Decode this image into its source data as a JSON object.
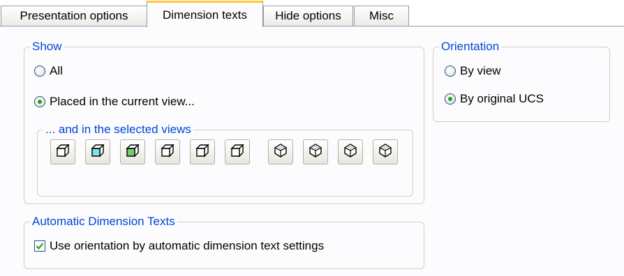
{
  "tabs": [
    {
      "label": "Presentation options",
      "active": false
    },
    {
      "label": "Dimension texts",
      "active": true
    },
    {
      "label": "Hide options",
      "active": false
    },
    {
      "label": "Misc",
      "active": false
    }
  ],
  "show": {
    "legend": "Show",
    "all_label": "All",
    "placed_label": "Placed in the current view...",
    "selected": "placed",
    "views": {
      "legend": "... and in the selected views",
      "buttons": [
        {
          "icon": "cube-iso-icon"
        },
        {
          "icon": "cube-iso-cyan-icon"
        },
        {
          "icon": "cube-iso-green-icon"
        },
        {
          "icon": "cube-iso-icon"
        },
        {
          "icon": "cube-iso-icon"
        },
        {
          "icon": "cube-iso-icon"
        },
        {
          "icon": "cube-corner-top-icon"
        },
        {
          "icon": "cube-corner-side-icon"
        },
        {
          "icon": "cube-corner-front-icon"
        },
        {
          "icon": "cube-corner-back-icon"
        }
      ]
    }
  },
  "orientation": {
    "legend": "Orientation",
    "by_view_label": "By view",
    "by_ucs_label": "By original UCS",
    "selected": "by_original_ucs"
  },
  "auto_dim": {
    "legend": "Automatic Dimension Texts",
    "checkbox_label": "Use orientation by automatic dimension text settings",
    "checked": true
  },
  "colors": {
    "accent": "#0046d5",
    "tab_highlight": "#ffc83c",
    "radio_dot": "#21a121"
  }
}
